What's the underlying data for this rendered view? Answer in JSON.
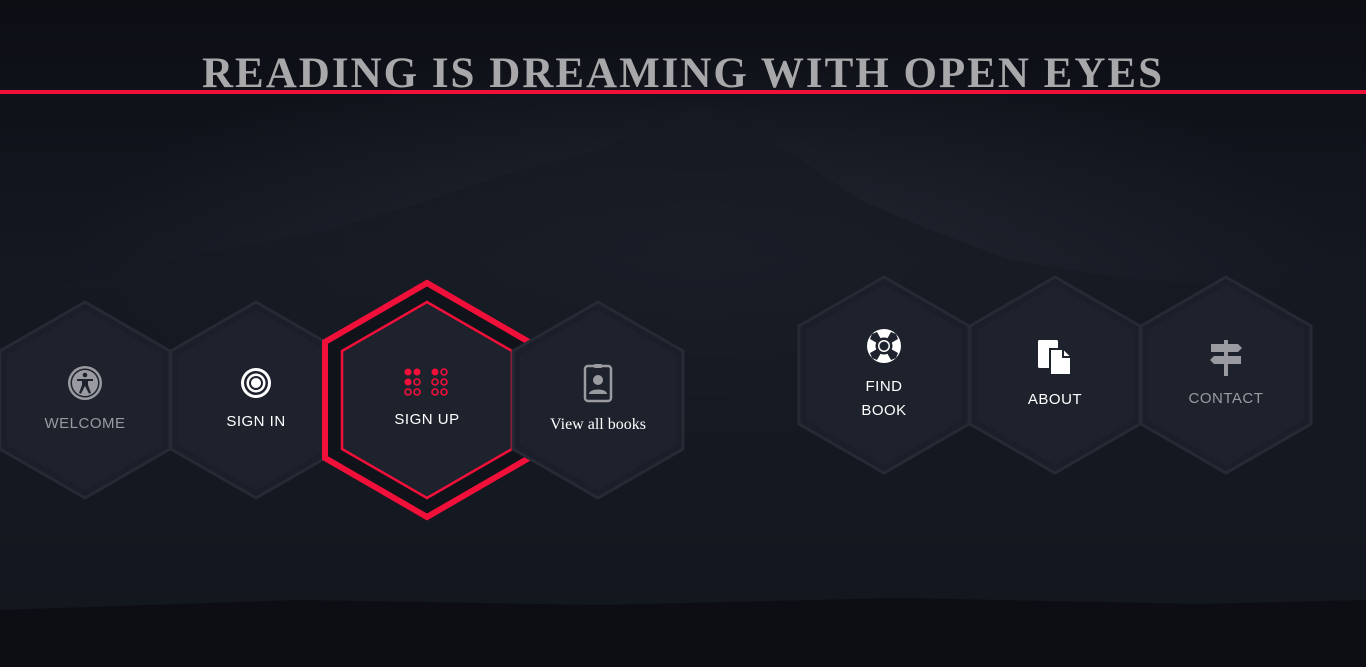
{
  "title": "READING IS DREAMING WITH OPEN EYES",
  "colors": {
    "accent": "#f0103a",
    "hex_fill": "#1e222d",
    "hex_border": "#2a2f3a",
    "text_muted": "#9a9ba0"
  },
  "left_nav": [
    {
      "label": "WELCOME",
      "icon": "accessibility-icon"
    },
    {
      "label": "SIGN IN",
      "icon": "target-icon"
    },
    {
      "label": "SIGN UP",
      "icon": "dots-grid-icon",
      "active": true
    },
    {
      "label": "View all books",
      "icon": "id-badge-icon"
    }
  ],
  "right_nav": [
    {
      "label_line1": "FIND",
      "label_line2": "BOOK",
      "icon": "life-ring-icon"
    },
    {
      "label": "ABOUT",
      "icon": "document-copy-icon"
    },
    {
      "label": "CONTACT",
      "icon": "signpost-icon"
    }
  ]
}
